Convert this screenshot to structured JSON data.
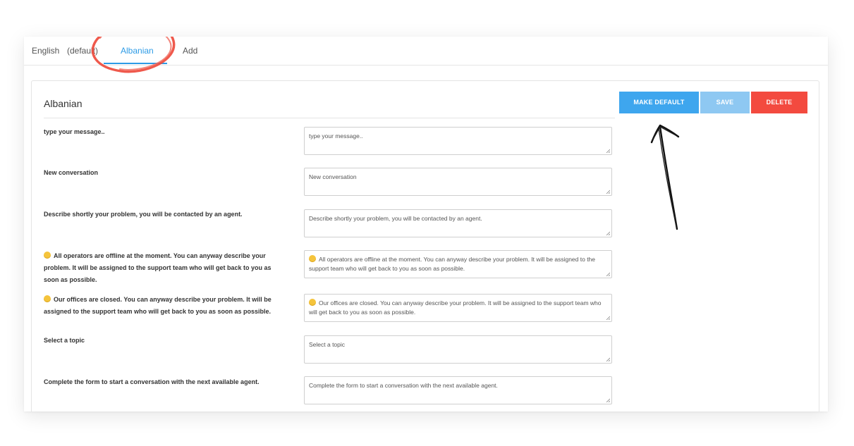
{
  "tabs": [
    {
      "label": "English",
      "active": false
    },
    {
      "label": "(default)",
      "active": false
    },
    {
      "label": "Albanian",
      "active": true
    },
    {
      "label": "Add",
      "active": false
    }
  ],
  "panel": {
    "title": "Albanian",
    "buttons": {
      "make_default": "MAKE DEFAULT",
      "save": "SAVE",
      "delete": "DELETE"
    }
  },
  "rows": [
    {
      "label": "type your message..",
      "value": "type your message.."
    },
    {
      "label": "New conversation",
      "value": "New conversation"
    },
    {
      "label": "Describe shortly your problem, you will be contacted by an agent.",
      "value": "Describe shortly your problem, you will be contacted by an agent."
    },
    {
      "label": "All operators are offline at the moment. You can anyway describe your problem. It will be assigned to the support team who will get back to you as soon as possible.",
      "value": "All operators are offline at the moment. You can anyway describe your problem. It will be assigned to the support team who will get back to you as soon as possible."
    },
    {
      "label": "Our offices are closed. You can anyway describe your problem. It will be assigned to the support team who will get back to you as soon as possible.",
      "value": "Our offices are closed. You can anyway describe your problem. It will be assigned to the support team who will get back to you as soon as possible."
    },
    {
      "label": "Select a topic",
      "value": "Select a topic"
    },
    {
      "label": "Complete the form to start a conversation with the next available agent.",
      "value": "Complete the form to start a conversation with the next available agent."
    }
  ],
  "icons": {
    "emoji": "thinking-face-icon",
    "annotation_circle": "red-circle-annotation",
    "annotation_arrow": "hand-drawn-arrow-up"
  },
  "colors": {
    "accent": "#2d9be6",
    "make_default": "#3ea6ee",
    "save": "#8ec8f2",
    "delete": "#f34a3f",
    "annotation_circle": "#ee4b3d"
  }
}
